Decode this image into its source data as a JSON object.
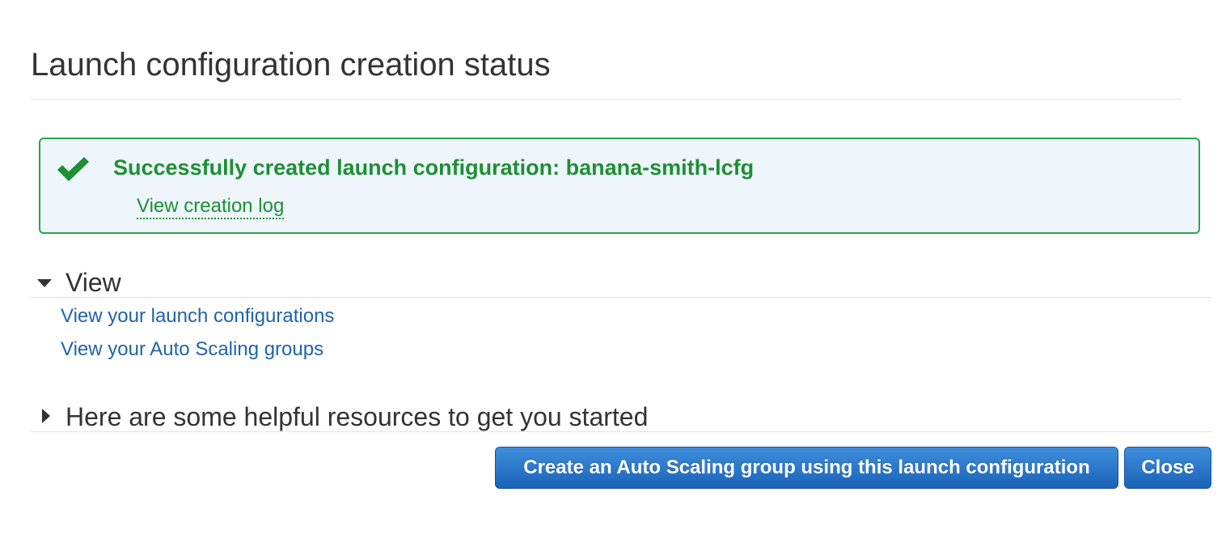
{
  "page": {
    "title": "Launch configuration creation status"
  },
  "success": {
    "icon": "checkmark-icon",
    "message": "Successfully created launch configuration: banana-smith-lcfg",
    "log_link": "View creation log",
    "colors": {
      "text": "#1e8f34",
      "border": "#2aa54b",
      "background": "#eef6fc"
    }
  },
  "sections": {
    "view": {
      "label": "View",
      "expanded": true,
      "icon": "caret-down-icon",
      "links": [
        "View your launch configurations",
        "View your Auto Scaling groups"
      ]
    },
    "resources": {
      "label": "Here are some helpful resources to get you started",
      "expanded": false,
      "icon": "caret-right-icon"
    }
  },
  "actions": {
    "create_label": "Create an Auto Scaling group using this launch configuration",
    "close_label": "Close",
    "accent": "#1a63b8"
  }
}
